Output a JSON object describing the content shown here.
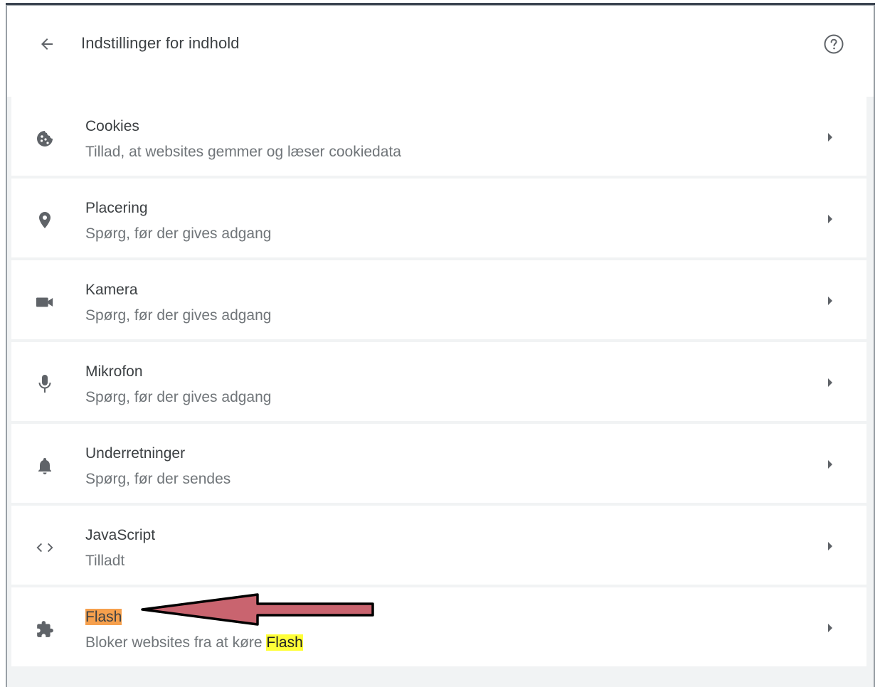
{
  "header": {
    "title": "Indstillinger for indhold",
    "back_icon": "arrow-back-icon",
    "help_icon": "help-icon"
  },
  "items": [
    {
      "title": "Cookies",
      "subtitle": "Tillad, at websites gemmer og læser cookiedata",
      "icon": "cookie-icon"
    },
    {
      "title": "Placering",
      "subtitle": "Spørg, før der gives adgang",
      "icon": "location-pin-icon"
    },
    {
      "title": "Kamera",
      "subtitle": "Spørg, før der gives adgang",
      "icon": "camera-icon"
    },
    {
      "title": "Mikrofon",
      "subtitle": "Spørg, før der gives adgang",
      "icon": "microphone-icon"
    },
    {
      "title": "Underretninger",
      "subtitle": "Spørg, før der sendes",
      "icon": "bell-icon"
    },
    {
      "title": "JavaScript",
      "subtitle": "Tilladt",
      "icon": "code-brackets-icon"
    },
    {
      "title": "Flash",
      "subtitle_prefix": "Bloker websites fra at køre ",
      "subtitle_highlight": "Flash",
      "icon": "puzzle-piece-icon"
    }
  ],
  "colors": {
    "title_highlight": "#f6a04d",
    "subtitle_highlight": "#ffff38",
    "annotation_arrow": "#c9646f"
  }
}
